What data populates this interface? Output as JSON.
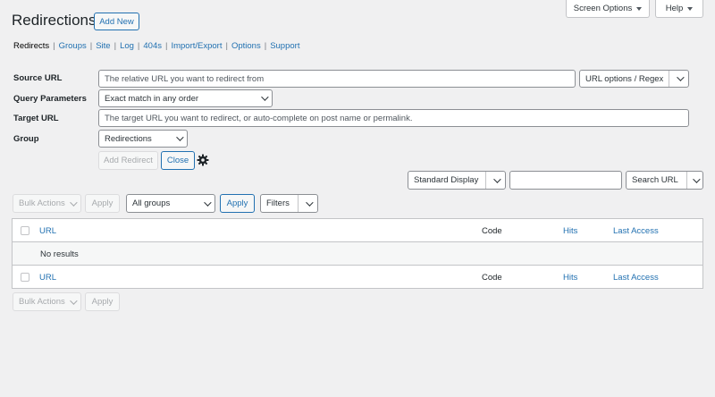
{
  "header": {
    "title": "Redirections",
    "add_new_label": "Add New",
    "screen_options_label": "Screen Options",
    "help_label": "Help"
  },
  "subnav": {
    "items": [
      {
        "label": "Redirects",
        "current": true
      },
      {
        "label": "Groups",
        "current": false
      },
      {
        "label": "Site",
        "current": false
      },
      {
        "label": "Log",
        "current": false
      },
      {
        "label": "404s",
        "current": false
      },
      {
        "label": "Import/Export",
        "current": false
      },
      {
        "label": "Options",
        "current": false
      },
      {
        "label": "Support",
        "current": false
      }
    ],
    "separator": "|"
  },
  "form": {
    "source_url_label": "Source URL",
    "source_url_placeholder": "The relative URL you want to redirect from",
    "url_options_value": "URL options / Regex",
    "query_params_label": "Query Parameters",
    "query_params_value": "Exact match in any order",
    "target_url_label": "Target URL",
    "target_url_placeholder": "The target URL you want to redirect, or auto-complete on post name or permalink.",
    "group_label": "Group",
    "group_value": "Redirections",
    "add_redirect_label": "Add Redirect",
    "close_label": "Close"
  },
  "search": {
    "display_value": "Standard Display",
    "search_input_value": "",
    "search_type_value": "Search URL"
  },
  "toolbar_top": {
    "bulk_actions_label": "Bulk Actions",
    "apply_label": "Apply",
    "groups_filter_value": "All groups",
    "groups_apply_label": "Apply",
    "filters_label": "Filters"
  },
  "table": {
    "columns": {
      "url": "URL",
      "code": "Code",
      "hits": "Hits",
      "last_access": "Last Access"
    },
    "empty_message": "No results"
  },
  "toolbar_bottom": {
    "bulk_actions_label": "Bulk Actions",
    "apply_label": "Apply"
  },
  "colors": {
    "accent": "#2271b1",
    "background": "#f0f0f1"
  }
}
